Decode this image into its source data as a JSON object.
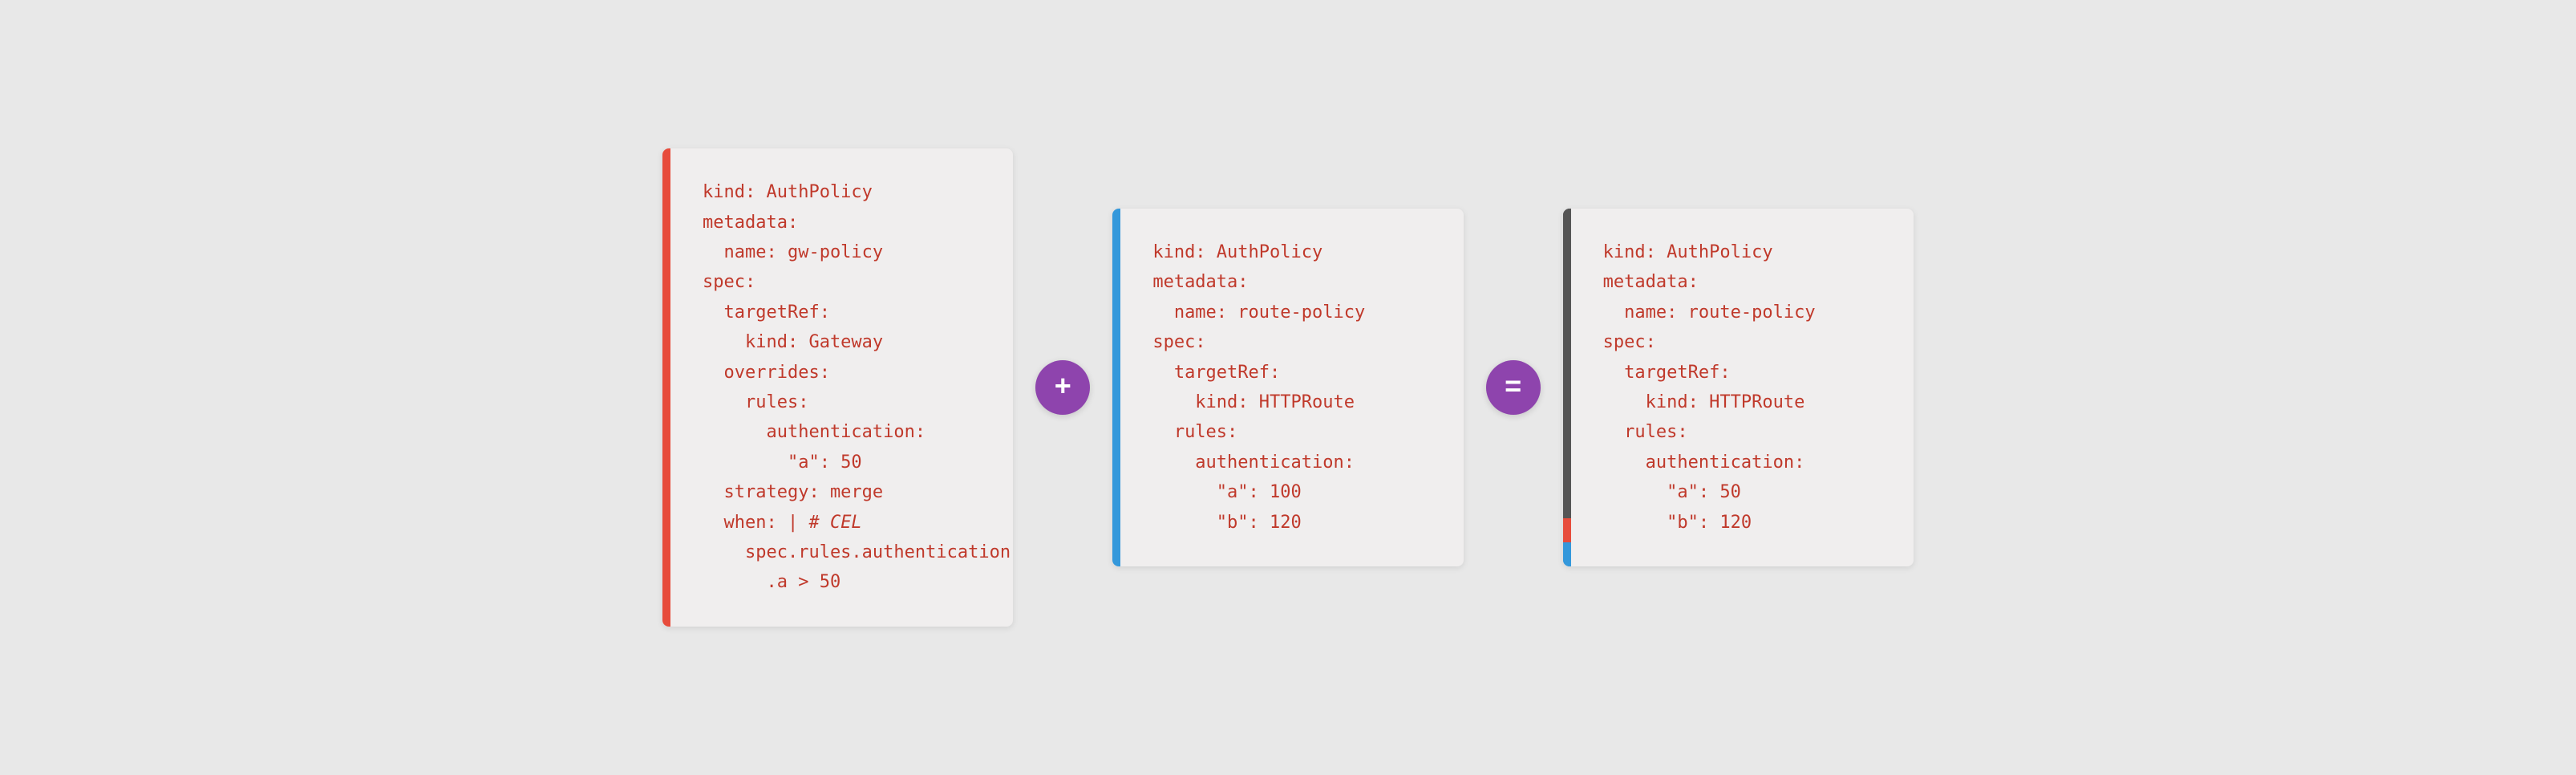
{
  "card1": {
    "border_color": "#e74c3c",
    "code": "kind: AuthPolicy\nmetadata:\n  name: gw-policy\nspec:\n  targetRef:\n    kind: Gateway\n  overrides:\n    rules:\n      authentication:\n        \"a\": 50\n  strategy: merge\n  when: | # CEL\n    spec.rules.authentication\n      .a > 50"
  },
  "card2": {
    "border_color": "#3498db",
    "code": "kind: AuthPolicy\nmetadata:\n  name: route-policy\nspec:\n  targetRef:\n    kind: HTTPRoute\n  rules:\n    authentication:\n      \"a\": 100\n      \"b\": 120"
  },
  "card3": {
    "code": "kind: AuthPolicy\nmetadata:\n  name: route-policy\nspec:\n  targetRef:\n    kind: HTTPRoute\n  rules:\n    authentication:\n      \"a\": 50\n      \"b\": 120"
  },
  "operators": {
    "plus": "+",
    "equals": "="
  }
}
